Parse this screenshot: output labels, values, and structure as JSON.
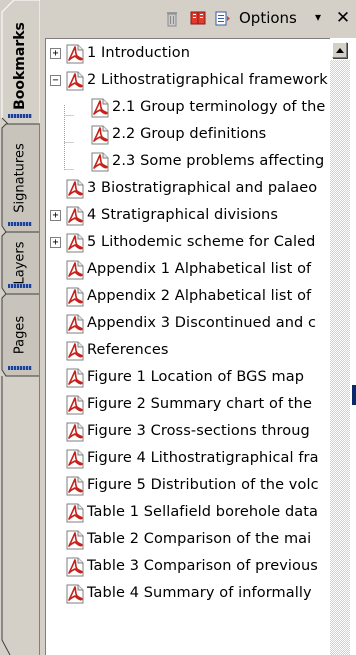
{
  "tabs": [
    {
      "label": "Bookmarks"
    },
    {
      "label": "Signatures"
    },
    {
      "label": "Layers"
    },
    {
      "label": "Pages"
    }
  ],
  "toolbar": {
    "trash_icon": "trash-icon",
    "new_bookmark_icon": "new-bookmark-icon",
    "expand_icon": "expand-bookmark-icon",
    "options_label": "Options",
    "options_arrow": "▾",
    "close_label": "✕"
  },
  "bookmarks": [
    {
      "label": "1  Introduction",
      "expander": "+",
      "level": 0
    },
    {
      "label": "2  Lithostratigraphical framework",
      "expander": "−",
      "level": 0
    },
    {
      "label": "2.1  Group terminology of the",
      "expander": "",
      "level": 1
    },
    {
      "label": "2.2  Group definitions",
      "expander": "",
      "level": 1
    },
    {
      "label": "2.3  Some problems affecting",
      "expander": "",
      "level": 1
    },
    {
      "label": "3  Biostratigraphical and palaeo",
      "expander": "",
      "level": 0
    },
    {
      "label": "4  Stratigraphical divisions",
      "expander": "+",
      "level": 0
    },
    {
      "label": "5  Lithodemic scheme for Caled",
      "expander": "+",
      "level": 0
    },
    {
      "label": "Appendix 1  Alphabetical list of",
      "expander": "",
      "level": 0
    },
    {
      "label": "Appendix 2  Alphabetical list of",
      "expander": "",
      "level": 0
    },
    {
      "label": "Appendix 3  Discontinued and c",
      "expander": "",
      "level": 0
    },
    {
      "label": "References",
      "expander": "",
      "level": 0
    },
    {
      "label": "Figure 1  Location of BGS map",
      "expander": "",
      "level": 0
    },
    {
      "label": "Figure 2  Summary chart of the",
      "expander": "",
      "level": 0
    },
    {
      "label": "Figure 3  Cross-sections throug",
      "expander": "",
      "level": 0
    },
    {
      "label": "Figure 4  Lithostratigraphical fra",
      "expander": "",
      "level": 0
    },
    {
      "label": "Figure 5  Distribution of the volc",
      "expander": "",
      "level": 0
    },
    {
      "label": "Table 1  Sellafield borehole data",
      "expander": "",
      "level": 0
    },
    {
      "label": "Table 2  Comparison of the mai",
      "expander": "",
      "level": 0
    },
    {
      "label": "Table 3  Comparison of previous",
      "expander": "",
      "level": 0
    },
    {
      "label": "Table 4  Summary of informally",
      "expander": "",
      "level": 0
    }
  ],
  "colors": {
    "accent": "#1c3f94",
    "pdf_red": "#c8201a",
    "panel": "#d4d0c8"
  }
}
